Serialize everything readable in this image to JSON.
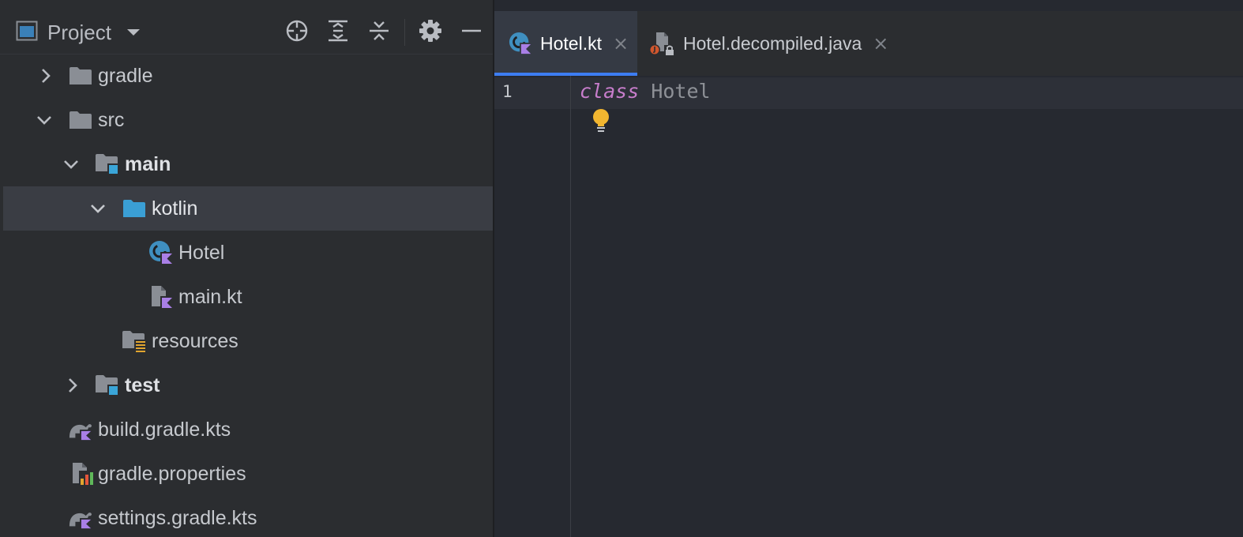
{
  "project_panel": {
    "title": "Project",
    "tools": [
      "locate-icon",
      "expand-all-icon",
      "collapse-all-icon",
      "gear-icon",
      "minimize-icon"
    ],
    "tree": [
      {
        "label": "gradle",
        "icon": "folder-icon",
        "chevron": "right",
        "bold": false
      },
      {
        "label": "src",
        "icon": "folder-icon",
        "chevron": "down",
        "bold": false
      },
      {
        "label": "main",
        "icon": "source-root-folder-icon",
        "chevron": "down",
        "bold": true
      },
      {
        "label": "kotlin",
        "icon": "kotlin-source-folder-icon",
        "chevron": "down",
        "bold": false,
        "selected": true
      },
      {
        "label": "Hotel",
        "icon": "kotlin-class-icon",
        "chevron": null,
        "bold": false
      },
      {
        "label": "main.kt",
        "icon": "kotlin-file-icon",
        "chevron": null,
        "bold": false
      },
      {
        "label": "resources",
        "icon": "resources-folder-icon",
        "chevron": null,
        "bold": false
      },
      {
        "label": "test",
        "icon": "test-root-folder-icon",
        "chevron": "right",
        "bold": true
      },
      {
        "label": "build.gradle.kts",
        "icon": "gradle-kotlin-script-icon",
        "chevron": null,
        "bold": false
      },
      {
        "label": "gradle.properties",
        "icon": "properties-file-icon",
        "chevron": null,
        "bold": false
      },
      {
        "label": "settings.gradle.kts",
        "icon": "gradle-kotlin-script-icon",
        "chevron": null,
        "bold": false
      }
    ]
  },
  "editor": {
    "tabs": [
      {
        "label": "Hotel.kt",
        "icon": "kotlin-class-icon",
        "active": true
      },
      {
        "label": "Hotel.decompiled.java",
        "icon": "java-decompiled-file-icon",
        "active": false
      }
    ],
    "close_glyph": "×",
    "line_numbers": [
      "1"
    ],
    "code": {
      "keyword": "class",
      "identifier": "Hotel"
    }
  },
  "colors": {
    "accent": "#3d7df2",
    "keyword": "#c77dcb",
    "selection": "#3a3d44",
    "folder": "#8a8e95",
    "kotlin_folder": "#3a9fd5",
    "bulb": "#f2b630"
  }
}
